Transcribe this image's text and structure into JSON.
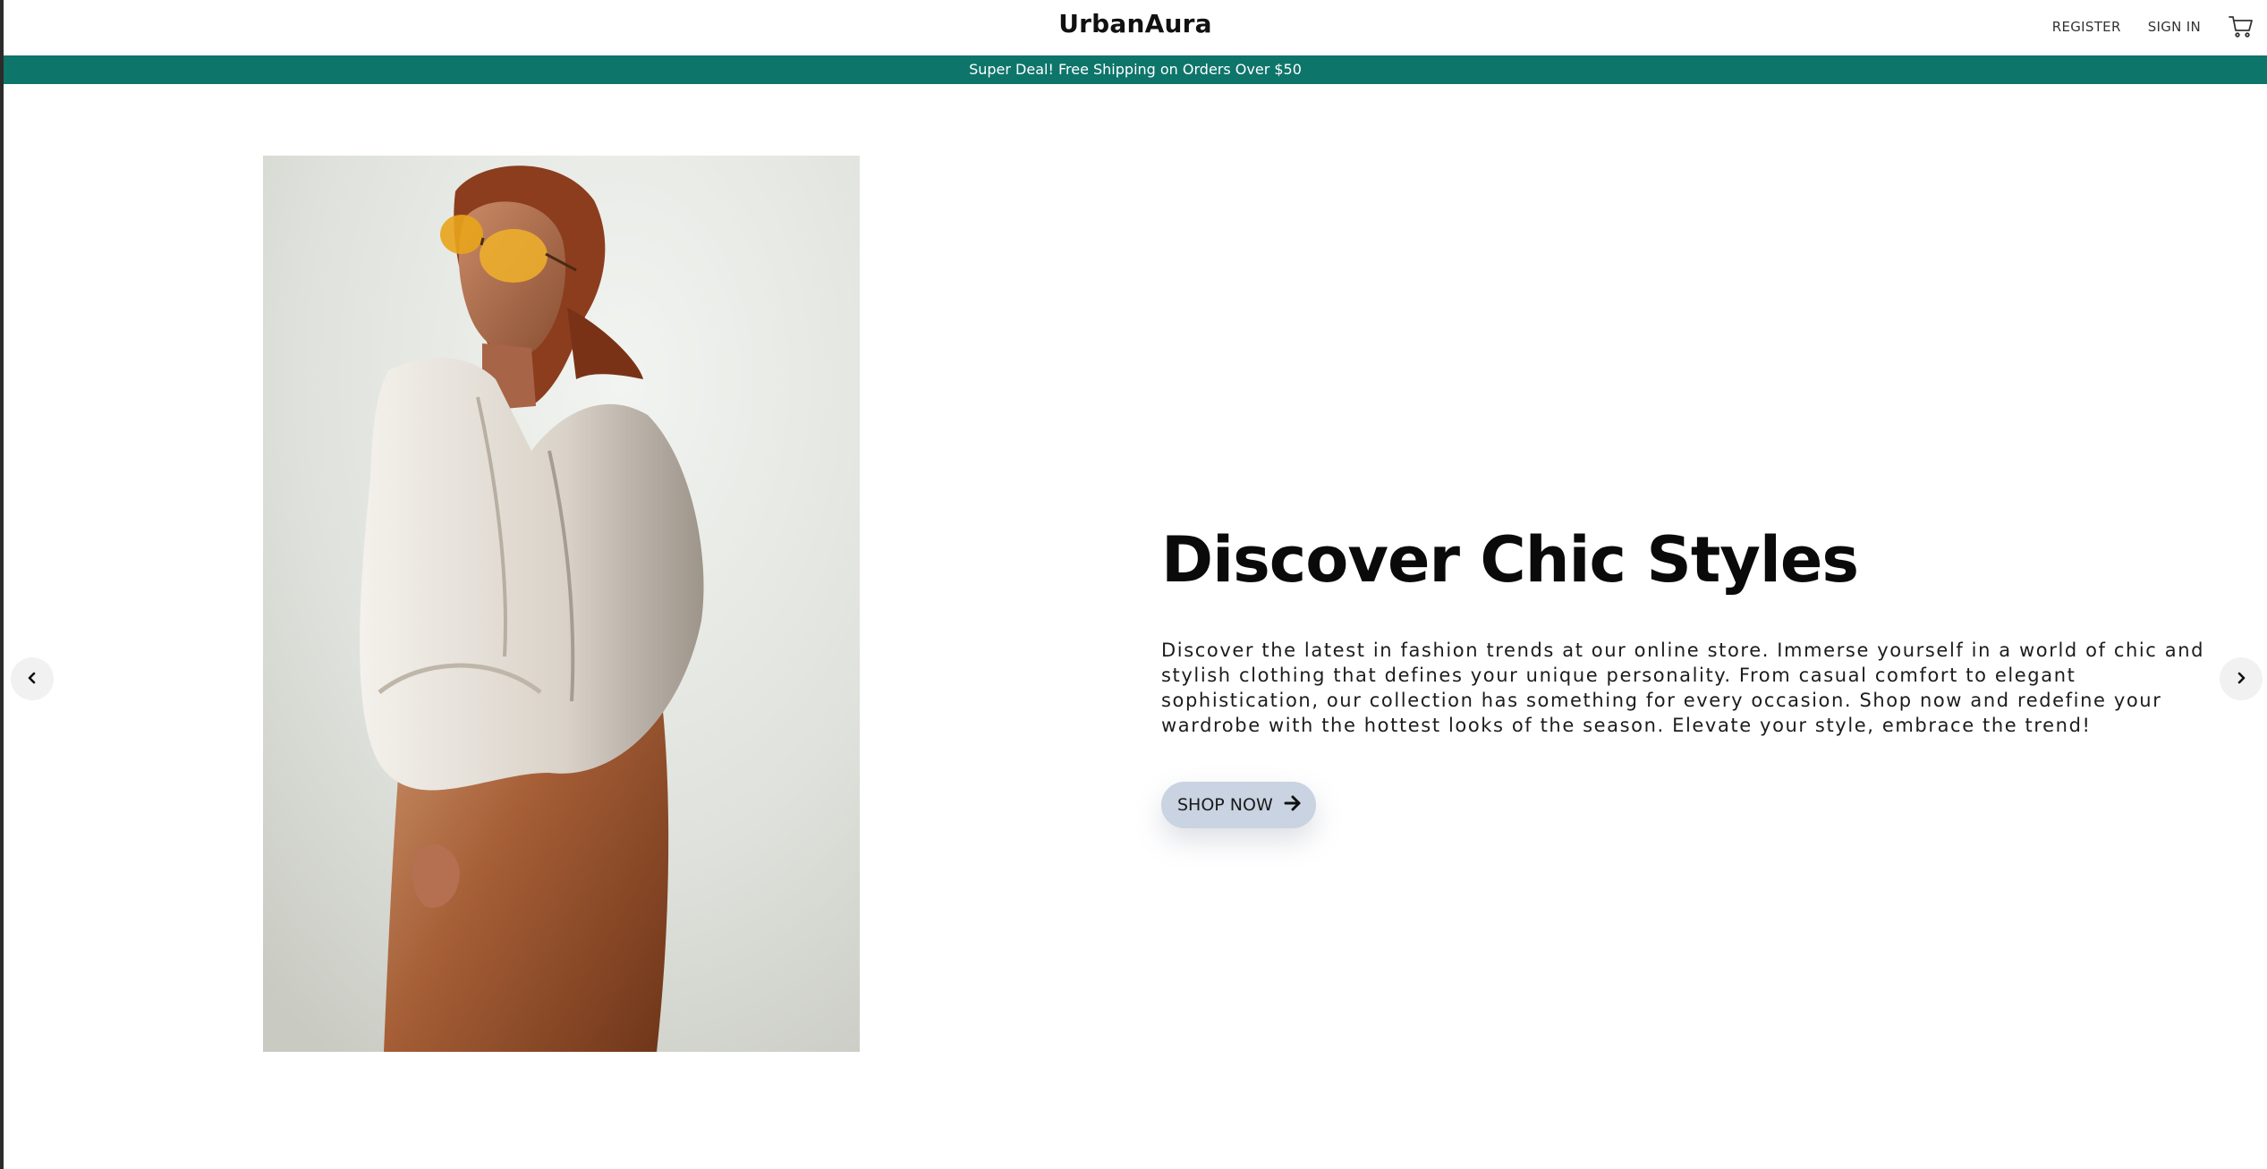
{
  "header": {
    "brand": "UrbanAura",
    "register_label": "REGISTER",
    "signin_label": "SIGN IN",
    "cart_icon": "cart-icon"
  },
  "promo": {
    "text": "Super Deal! Free Shipping on Orders Over $50",
    "color": "#0e756b"
  },
  "hero": {
    "title": "Discover Chic Styles",
    "description": "Discover the latest in fashion trends at our online store. Immerse yourself in a world of chic and stylish clothing that defines your unique personality. From casual comfort to elegant sophistication, our collection has something for every occasion. Shop now and redefine your wardrobe with the hottest looks of the season. Elevate your style, embrace the trend!",
    "cta_label": "SHOP NOW",
    "cta_icon": "arrow-right-icon",
    "cta_color": "#c9d3e1"
  },
  "carousel": {
    "prev_icon": "chevron-left-icon",
    "next_icon": "chevron-right-icon"
  }
}
